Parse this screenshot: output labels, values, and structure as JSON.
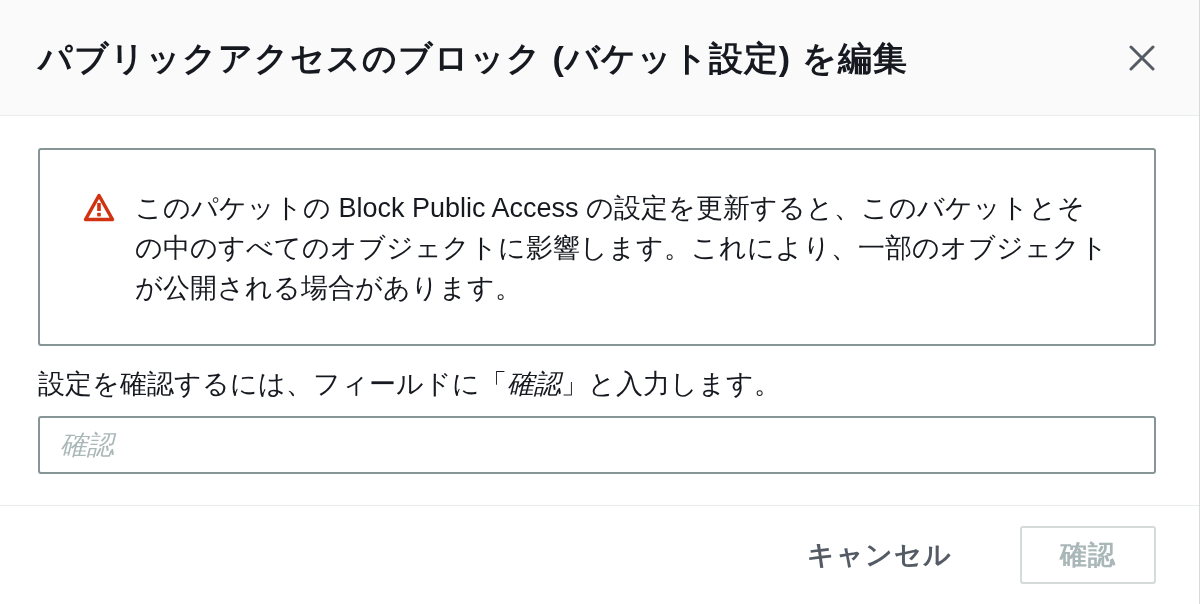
{
  "dialog": {
    "title": "パブリックアクセスのブロック (バケット設定) を編集"
  },
  "alert": {
    "kind": "warning",
    "message": "このパケットの Block Public Access の設定を更新すると、このバケットとその中のすべてのオブジェクトに影響します。これにより、一部のオブジェクトが公開される場合があります。"
  },
  "confirmation": {
    "label": "設定を確認するには、フィールドに「*確認*」と入力します。",
    "input": {
      "placeholder": "確認"
    }
  },
  "buttons": [
    {
      "label": "キャンセル",
      "kind": "link",
      "disabled": false
    },
    {
      "label": "確認",
      "kind": "primary",
      "disabled": true
    }
  ]
}
